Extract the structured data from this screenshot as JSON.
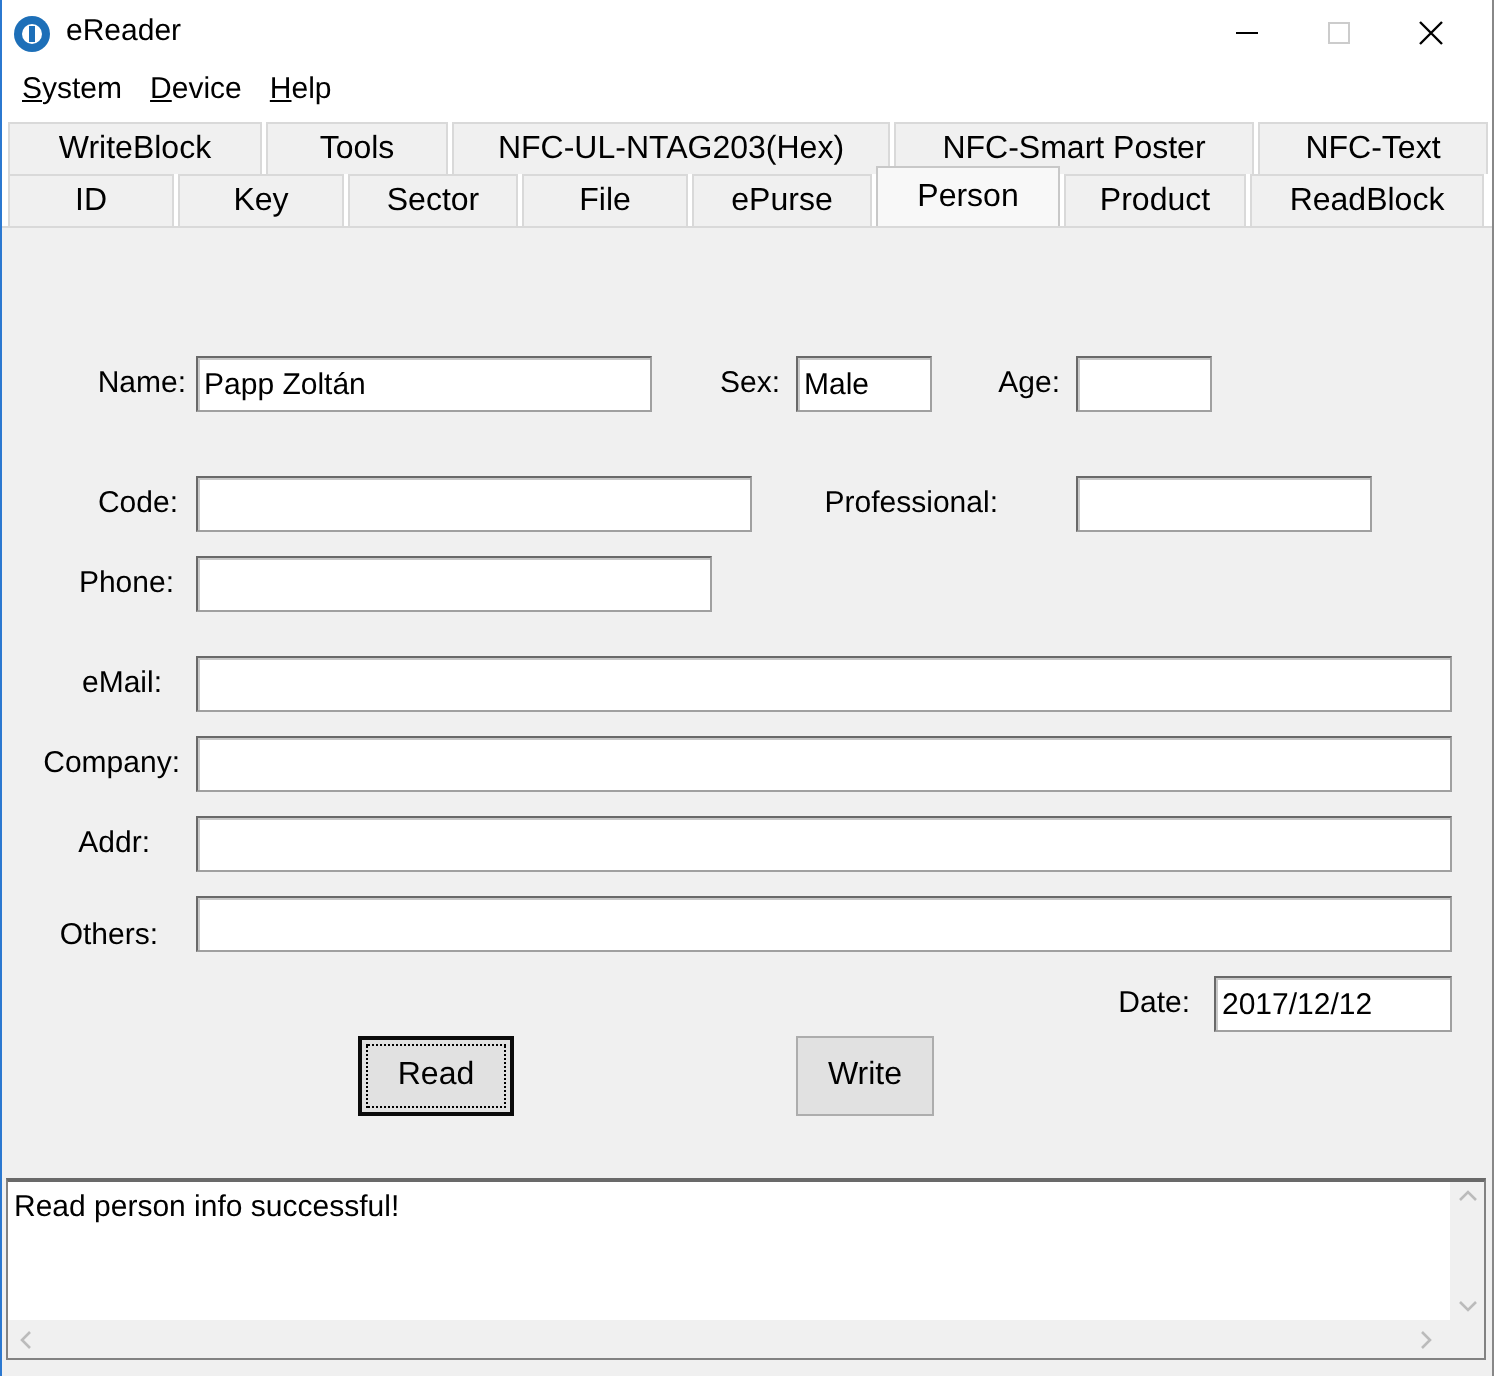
{
  "window": {
    "title": "eReader"
  },
  "menu": [
    {
      "label": "System",
      "first_letter_underlined": true
    },
    {
      "label": "Device",
      "first_letter_underlined": true
    },
    {
      "label": "Help",
      "first_letter_underlined": true
    }
  ],
  "tab_rows": [
    {
      "tabs": [
        {
          "label": "WriteBlock",
          "selected": false
        },
        {
          "label": "Tools",
          "selected": false
        },
        {
          "label": "NFC-UL-NTAG203(Hex)",
          "selected": false
        },
        {
          "label": "NFC-Smart Poster",
          "selected": false
        },
        {
          "label": "NFC-Text",
          "selected": false
        }
      ]
    },
    {
      "tabs": [
        {
          "label": "ID",
          "selected": false
        },
        {
          "label": "Key",
          "selected": false
        },
        {
          "label": "Sector",
          "selected": false
        },
        {
          "label": "File",
          "selected": false
        },
        {
          "label": "ePurse",
          "selected": false
        },
        {
          "label": "Person",
          "selected": true
        },
        {
          "label": "Product",
          "selected": false
        },
        {
          "label": "ReadBlock",
          "selected": false
        }
      ]
    }
  ],
  "form": {
    "rows": [
      {
        "fields": [
          {
            "label": "Name:",
            "value": "Papp Zoltán"
          },
          {
            "label": "Sex:",
            "value": "Male"
          },
          {
            "label": "Age:"
          }
        ]
      },
      {
        "fields": [
          {
            "label": "Code:"
          },
          {
            "label": "Professional:"
          }
        ]
      },
      {
        "fields": [
          {
            "label": "Phone:"
          }
        ]
      },
      {
        "fields": [
          {
            "label": "eMail:"
          }
        ]
      },
      {
        "fields": [
          {
            "label": "Company:"
          }
        ]
      },
      {
        "fields": [
          {
            "label": "Addr:"
          }
        ]
      },
      {
        "fields": [
          {
            "label": "Others:"
          }
        ]
      },
      {
        "fields": [
          {
            "label": "Date:",
            "value": "2017/12/12"
          }
        ]
      }
    ]
  },
  "buttons": [
    {
      "label": "Read",
      "focused": true
    },
    {
      "label": "Write",
      "focused": false
    }
  ],
  "log": {
    "text": "Read person info successful!"
  }
}
